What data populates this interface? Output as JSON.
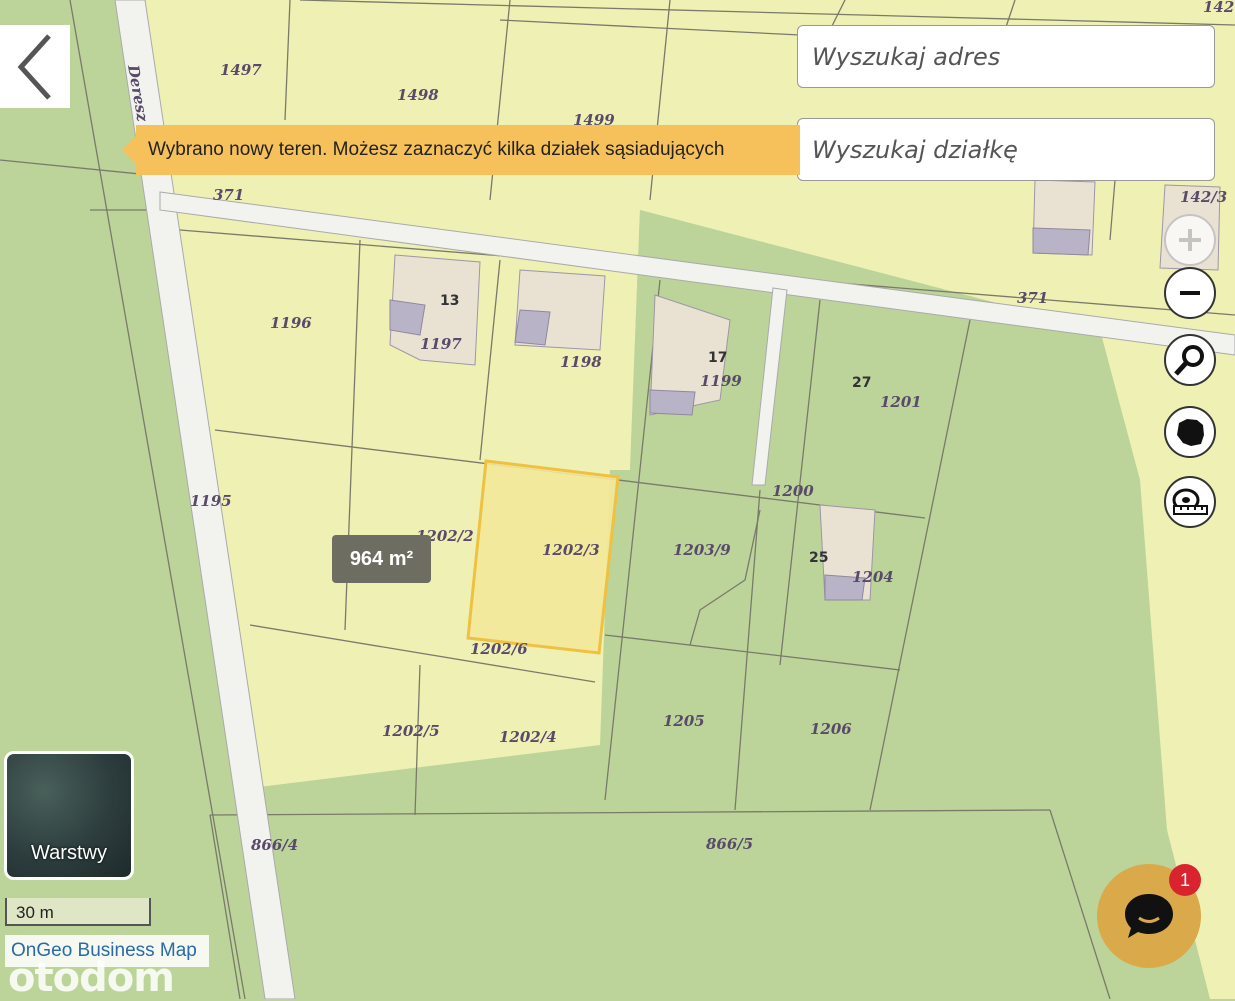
{
  "search": {
    "address_placeholder": "Wyszukaj adres",
    "parcel_placeholder": "Wyszukaj działkę"
  },
  "tooltip": {
    "text": "Wybrano nowy teren. Możesz zaznaczyć kilka działek sąsiadujących"
  },
  "selection": {
    "area": "964 m²"
  },
  "map": {
    "street_names": [
      "Deresz",
      "371",
      "371"
    ],
    "parcels": [
      "1497",
      "1498",
      "1499",
      "142",
      "142/3",
      "1196",
      "1197",
      "1198",
      "1199",
      "1201",
      "1195",
      "1202/2",
      "1202/3",
      "1203/9",
      "1200",
      "1204",
      "1202/6",
      "1202/5",
      "1202/4",
      "1205",
      "1206",
      "866/4",
      "866/5"
    ],
    "house_numbers": [
      "13",
      "17",
      "27",
      "25"
    ]
  },
  "controls": {
    "zoom_in_icon": "plus-icon",
    "zoom_out_icon": "minus-icon",
    "search_icon": "magnifier-icon",
    "country_icon": "poland-map-icon",
    "measure_icon": "tape-measure-icon"
  },
  "layers": {
    "label": "Warstwy"
  },
  "scale": {
    "label": "30 m"
  },
  "attribution": {
    "label": "OnGeo Business Map"
  },
  "watermark": {
    "text": "otodom"
  },
  "chat": {
    "badge_count": "1"
  },
  "colors": {
    "parcel_fill": "#eef0b4",
    "forest_fill": "#bcd49a",
    "selected_fill": "#f3e89a",
    "selected_border": "#f0c040",
    "road": "#f2f2ee",
    "accent": "#f6c15a"
  }
}
